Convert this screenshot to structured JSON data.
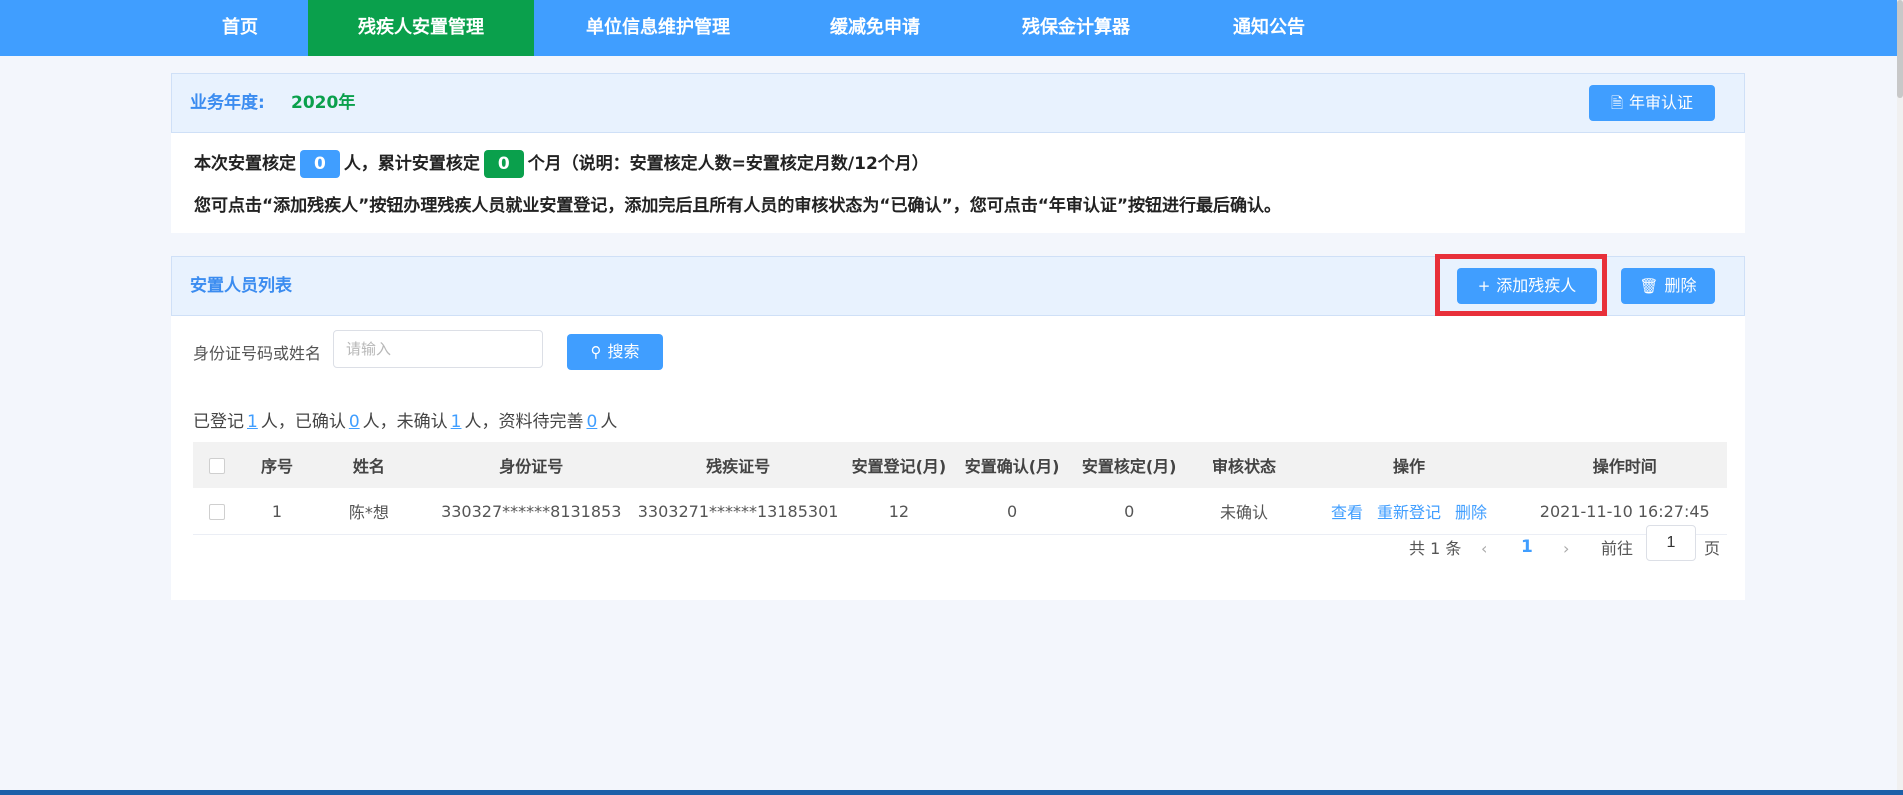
{
  "nav": {
    "items": [
      {
        "label": "首页"
      },
      {
        "label": "残疾人安置管理"
      },
      {
        "label": "单位信息维护管理"
      },
      {
        "label": "缓减免申请"
      },
      {
        "label": "残保金计算器"
      },
      {
        "label": "通知公告"
      }
    ],
    "active_index": 1
  },
  "year_panel": {
    "label": "业务年度:",
    "year": "2020年",
    "annual_button": "年审认证",
    "line1": {
      "prefix": "本次安置核定",
      "count": "0",
      "mid": "人，累计安置核定",
      "months": "0",
      "suffix": "个月（说明：安置核定人数=安置核定月数/12个月）"
    },
    "line2": "您可点击“添加残疾人”按钮办理残疾人员就业安置登记，添加完后且所有人员的审核状态为“已确认”，您可点击“年审认证”按钮进行最后确认。"
  },
  "list_panel": {
    "title": "安置人员列表",
    "add_button": "添加残疾人",
    "delete_button": "删除",
    "search": {
      "label": "身份证号码或姓名",
      "placeholder": "请输入",
      "value": "",
      "button": "搜索"
    },
    "summary": {
      "t1": "已登记",
      "registered": "1",
      "t2": "人，已确认",
      "confirmed": "0",
      "t3": "人，未确认",
      "unconfirmed": "1",
      "t4": "人，资料待完善",
      "incomplete": "0",
      "t5": "人"
    },
    "table": {
      "headers": [
        "序号",
        "姓名",
        "身份证号",
        "残疾证号",
        "安置登记(月)",
        "安置确认(月)",
        "安置核定(月)",
        "审核状态",
        "操作",
        "操作时间"
      ],
      "rows": [
        {
          "index": "1",
          "name": "陈*想",
          "id_number": "330327******8131853",
          "disability_cert": "3303271******13185301",
          "registered_months": "12",
          "confirmed_months": "0",
          "approved_months": "0",
          "status": "未确认",
          "actions": [
            "查看",
            "重新登记",
            "删除"
          ],
          "time": "2021-11-10 16:27:45"
        }
      ]
    },
    "pagination": {
      "total": "共 1 条",
      "current": "1",
      "goto_label": "前往",
      "goto_value": "1",
      "page_suffix": "页"
    }
  }
}
